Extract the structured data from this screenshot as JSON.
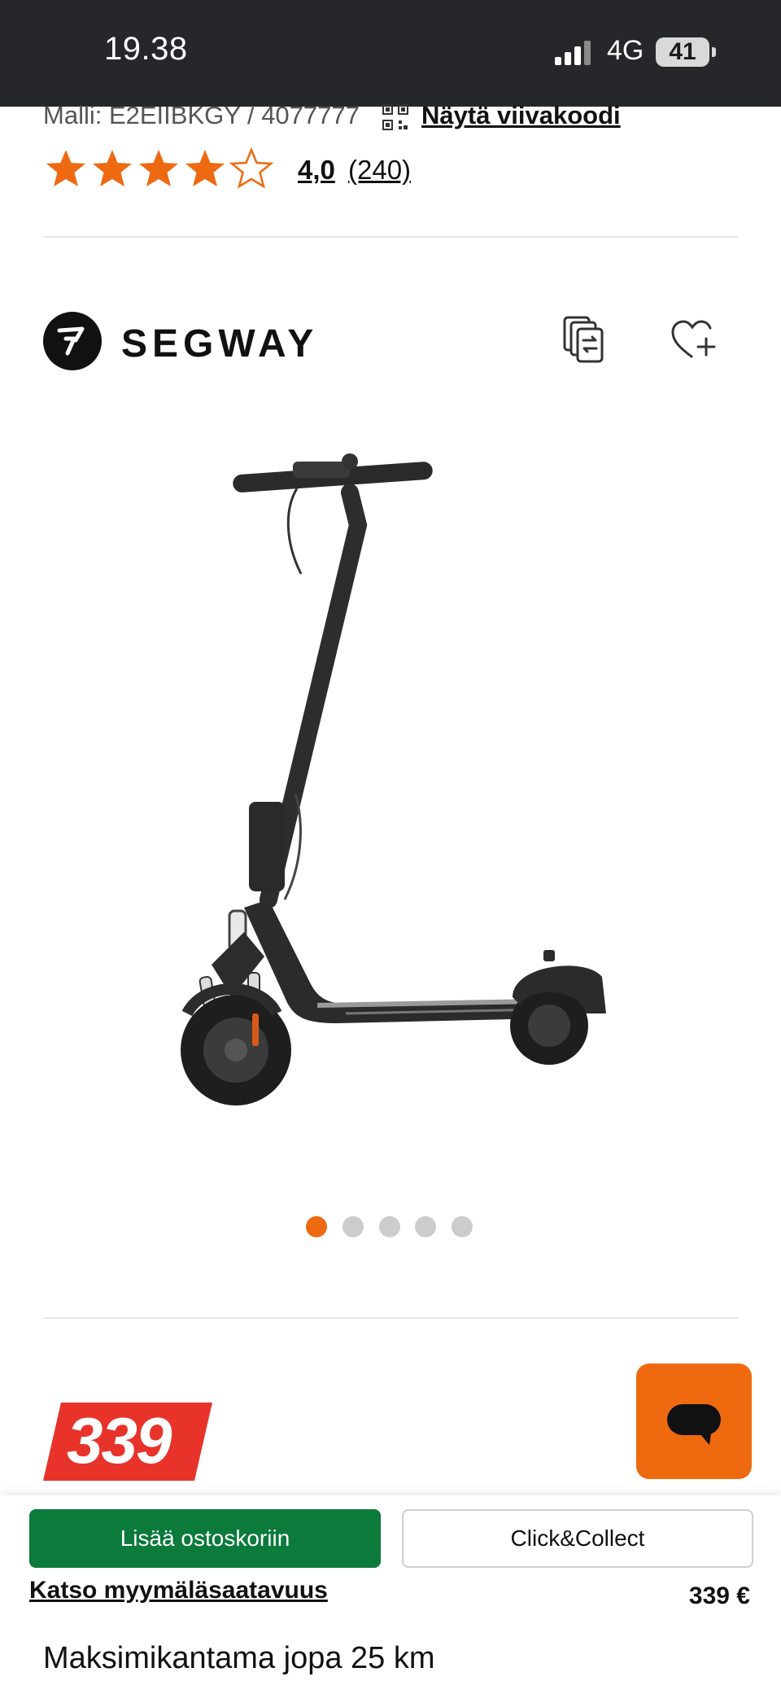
{
  "status_bar": {
    "time": "19.38",
    "network": "4G",
    "battery": "41"
  },
  "product": {
    "model_label": "Malli: E2EIIBKGY / 4077777",
    "barcode_link": "Näytä viivakoodi",
    "rating": {
      "value": "4,0",
      "count": "(240)",
      "stars": 4,
      "max_stars": 5
    },
    "brand": "SEGWAY",
    "price_badge": "339",
    "gallery": {
      "total": 5,
      "active_index": 0
    }
  },
  "colors": {
    "accent": "#ee6a12",
    "cart_green": "#0b7a3a",
    "price_red": "#e8332a"
  },
  "actions": {
    "add_to_cart": "Lisää ostoskoriin",
    "click_collect": "Click&Collect",
    "store_availability": "Katso myymäläsaatavuus",
    "price": "339 €"
  },
  "feature_heading": "Maksimikantama jopa 25 km"
}
